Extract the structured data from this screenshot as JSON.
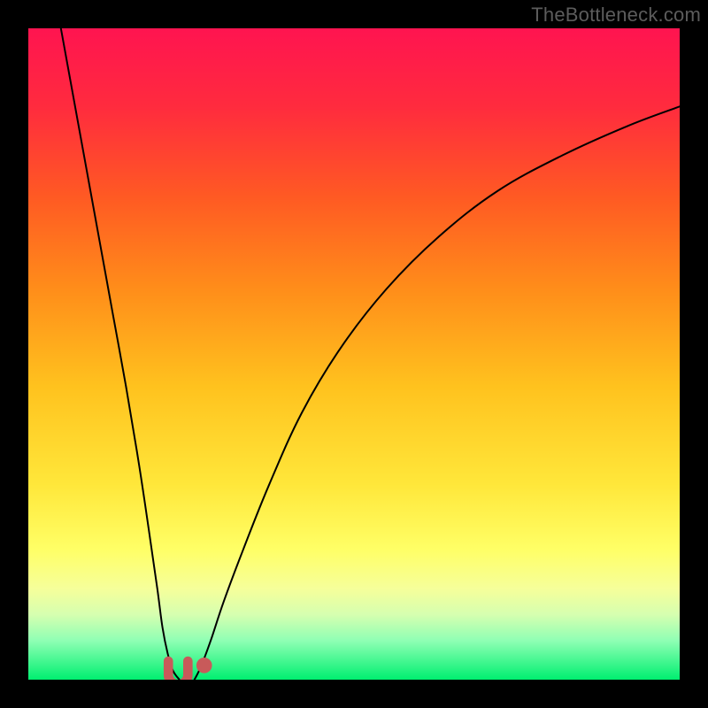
{
  "watermark": "TheBottleneck.com",
  "plot": {
    "outer_w": 800,
    "outer_h": 800,
    "inner_x": 32,
    "inner_y": 32,
    "inner_w": 736,
    "inner_h": 736
  },
  "gradient_stops": [
    {
      "pct": 0,
      "color": "#ff1450"
    },
    {
      "pct": 12,
      "color": "#ff2b3e"
    },
    {
      "pct": 26,
      "color": "#ff5a23"
    },
    {
      "pct": 40,
      "color": "#ff8d1a"
    },
    {
      "pct": 55,
      "color": "#ffc21e"
    },
    {
      "pct": 70,
      "color": "#ffe73a"
    },
    {
      "pct": 80,
      "color": "#ffff66"
    },
    {
      "pct": 86,
      "color": "#f6ff9a"
    },
    {
      "pct": 90,
      "color": "#d6ffb0"
    },
    {
      "pct": 94,
      "color": "#8fffb4"
    },
    {
      "pct": 100,
      "color": "#00ef70"
    }
  ],
  "chart_data": {
    "type": "line",
    "title": "",
    "xlabel": "",
    "ylabel": "",
    "xlim": [
      0,
      100
    ],
    "ylim": [
      0,
      100
    ],
    "y_axis_inverted": false,
    "series": [
      {
        "name": "left-branch",
        "x": [
          5,
          7,
          9,
          11,
          13,
          15,
          17,
          18.5,
          19.8,
          20.6,
          21.4,
          22.2,
          23.2
        ],
        "y": [
          100,
          89,
          78,
          67,
          56,
          45,
          33,
          23,
          14,
          8,
          4,
          1.4,
          0
        ]
      },
      {
        "name": "right-branch",
        "x": [
          25.5,
          26.5,
          28,
          30,
          33,
          37,
          42,
          48,
          55,
          63,
          72,
          82,
          92,
          100
        ],
        "y": [
          0,
          2,
          6,
          12,
          20,
          30,
          41,
          51,
          60,
          68,
          75,
          80.5,
          85,
          88
        ]
      }
    ],
    "markers": [
      {
        "name": "u-marker",
        "cx": 23.0,
        "cy": 1.2,
        "shape": "u",
        "w": 3.0,
        "h": 3.0,
        "color": "#c85a5a"
      },
      {
        "name": "dot-marker",
        "cx": 27.0,
        "cy": 2.2,
        "shape": "dot",
        "r": 1.2,
        "color": "#c85a5a"
      }
    ]
  }
}
